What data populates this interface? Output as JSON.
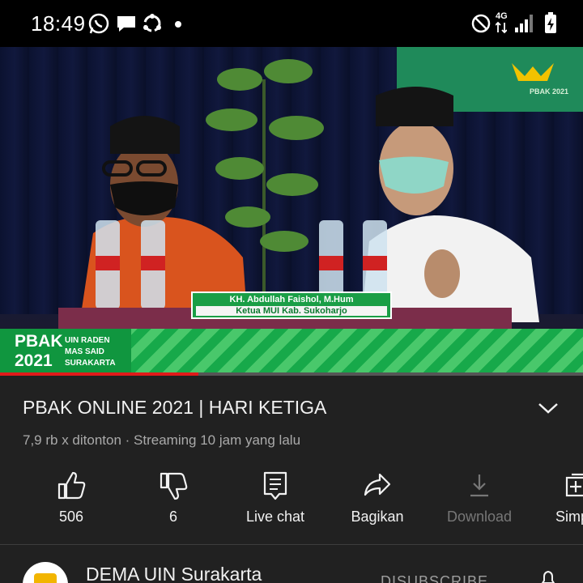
{
  "status_bar": {
    "time": "18:49",
    "left_icons": [
      "whatsapp-icon",
      "chat-icon",
      "sync-icon",
      "dot-icon"
    ],
    "right_icons": [
      "do-not-disturb-icon",
      "4g-signal-icon",
      "signal-icon",
      "battery-charging-icon"
    ],
    "network_label": "4G"
  },
  "video": {
    "name_tag_line1": "KH. Abdullah Faishol, M.Hum",
    "name_tag_line2": "Ketua MUI Kab. Sukoharjo",
    "strip_big_1": "PBAK",
    "strip_big_2": "2021",
    "strip_small_1": "UIN RADEN",
    "strip_small_2": "MAS SAID",
    "strip_small_3": "SURAKARTA",
    "banner_label": "PBAK 2021",
    "progress_fraction": 0.34,
    "accent_color": "#e01a1a"
  },
  "info": {
    "title": "PBAK ONLINE 2021 |  HARI KETIGA",
    "meta": "7,9 rb x ditonton · Streaming 10 jam yang lalu"
  },
  "actions": [
    {
      "icon": "thumbs-up-icon",
      "label": "506",
      "enabled": true
    },
    {
      "icon": "thumbs-down-icon",
      "label": "6",
      "enabled": true
    },
    {
      "icon": "live-chat-icon",
      "label": "Live chat",
      "enabled": true
    },
    {
      "icon": "share-icon",
      "label": "Bagikan",
      "enabled": true
    },
    {
      "icon": "download-icon",
      "label": "Download",
      "enabled": false
    },
    {
      "icon": "save-icon",
      "label": "Simp",
      "enabled": true
    }
  ],
  "channel": {
    "name": "DEMA UIN Surakarta",
    "subscribe_label": "DISUBSCRIBE"
  }
}
